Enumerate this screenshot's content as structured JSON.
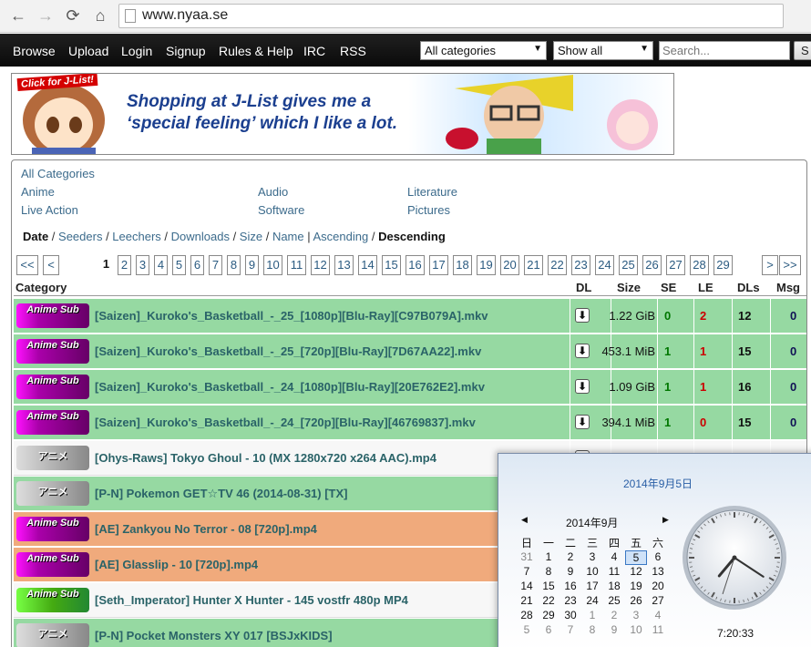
{
  "browser": {
    "url": "www.nyaa.se",
    "back_icon": "←",
    "forward_icon": "→",
    "reload_icon": "⟳",
    "home_icon": "⌂"
  },
  "nav": {
    "links": [
      "Browse",
      "Upload",
      "Login",
      "Signup",
      "Rules & Help",
      "IRC",
      "RSS"
    ],
    "category_select": "All categories",
    "filter_select": "Show all",
    "search_placeholder": "Search...",
    "search_button": "S"
  },
  "banner": {
    "tag": "Click for J-List!",
    "line1": "Shopping at J-List gives me a",
    "line2": "‘special feeling’ which I like a lot."
  },
  "categories": {
    "all": "All Categories",
    "anime": "Anime",
    "live_action": "Live Action",
    "audio": "Audio",
    "software": "Software",
    "literature": "Literature",
    "pictures": "Pictures"
  },
  "sort": {
    "date": "Date",
    "seeders": "Seeders",
    "leechers": "Leechers",
    "downloads": "Downloads",
    "size": "Size",
    "name": "Name",
    "ascending": "Ascending",
    "descending": "Descending"
  },
  "pagination": {
    "first": "<<",
    "prev": "<",
    "pages": [
      "1",
      "2",
      "3",
      "4",
      "5",
      "6",
      "7",
      "8",
      "9",
      "10",
      "11",
      "12",
      "13",
      "14",
      "15",
      "16",
      "17",
      "18",
      "19",
      "20",
      "21",
      "22",
      "23",
      "24",
      "25",
      "26",
      "27",
      "28",
      "29"
    ],
    "current": "1",
    "next": ">",
    "last": ">>"
  },
  "table": {
    "headers": {
      "category": "Category",
      "dl": "DL",
      "size": "Size",
      "se": "SE",
      "le": "LE",
      "dls": "DLs",
      "msg": "Msg"
    },
    "rows": [
      {
        "badge": "Anime Sub",
        "badge_type": "sub",
        "color": "green",
        "name": "[Saizen]_Kuroko's_Basketball_-_25_[1080p][Blu-Ray][C97B079A].mkv",
        "size": "1.22 GiB",
        "se": "0",
        "le": "2",
        "dls": "12",
        "msg": "0"
      },
      {
        "badge": "Anime Sub",
        "badge_type": "sub",
        "color": "green",
        "name": "[Saizen]_Kuroko's_Basketball_-_25_[720p][Blu-Ray][7D67AA22].mkv",
        "size": "453.1 MiB",
        "se": "1",
        "le": "1",
        "dls": "15",
        "msg": "0"
      },
      {
        "badge": "Anime Sub",
        "badge_type": "sub",
        "color": "green",
        "name": "[Saizen]_Kuroko's_Basketball_-_24_[1080p][Blu-Ray][20E762E2].mkv",
        "size": "1.09 GiB",
        "se": "1",
        "le": "1",
        "dls": "16",
        "msg": "0"
      },
      {
        "badge": "Anime Sub",
        "badge_type": "sub",
        "color": "green",
        "name": "[Saizen]_Kuroko's_Basketball_-_24_[720p][Blu-Ray][46769837].mkv",
        "size": "394.1 MiB",
        "se": "1",
        "le": "0",
        "dls": "15",
        "msg": "0"
      },
      {
        "badge": "アニメ",
        "badge_type": "raw",
        "color": "white",
        "name": "[Ohys-Raws] Tokyo Ghoul - 10 (MX 1280x720 x264 AAC).mp4",
        "size": "",
        "se": "",
        "le": "",
        "dls": "",
        "msg": ""
      },
      {
        "badge": "アニメ",
        "badge_type": "raw",
        "color": "green",
        "name": "[P-N] Pokemon GET☆TV 46 (2014-08-31) [TX]",
        "size": "",
        "se": "",
        "le": "",
        "dls": "",
        "msg": ""
      },
      {
        "badge": "Anime Sub",
        "badge_type": "sub",
        "color": "orange",
        "name": "[AE] Zankyou No Terror - 08 [720p].mp4",
        "size": "",
        "se": "",
        "le": "",
        "dls": "",
        "msg": ""
      },
      {
        "badge": "Anime Sub",
        "badge_type": "sub",
        "color": "orange",
        "name": "[AE] Glasslip - 10 [720p].mp4",
        "size": "",
        "se": "",
        "le": "",
        "dls": "",
        "msg": ""
      },
      {
        "badge": "Anime Sub",
        "badge_type": "nonen",
        "color": "white",
        "name": "[Seth_Imperator] Hunter X Hunter - 145 vostfr 480p MP4",
        "size": "",
        "se": "",
        "le": "",
        "dls": "",
        "msg": ""
      },
      {
        "badge": "アニメ",
        "badge_type": "raw",
        "color": "green",
        "name": "[P-N] Pocket Monsters XY 017 [BSJxKIDS]",
        "size": "",
        "se": "",
        "le": "",
        "dls": "",
        "msg": ""
      }
    ]
  },
  "calendar": {
    "full_date": "2014年9月5日",
    "month": "2014年9月",
    "weekdays": [
      "日",
      "一",
      "二",
      "三",
      "四",
      "五",
      "六"
    ],
    "weeks": [
      [
        "31",
        "1",
        "2",
        "3",
        "4",
        "5",
        "6"
      ],
      [
        "7",
        "8",
        "9",
        "10",
        "11",
        "12",
        "13"
      ],
      [
        "14",
        "15",
        "16",
        "17",
        "18",
        "19",
        "20"
      ],
      [
        "21",
        "22",
        "23",
        "24",
        "25",
        "26",
        "27"
      ],
      [
        "28",
        "29",
        "30",
        "1",
        "2",
        "3",
        "4"
      ],
      [
        "5",
        "6",
        "7",
        "8",
        "9",
        "10",
        "11"
      ]
    ],
    "today": "5",
    "time": "7:20:33",
    "clock_hours": 7,
    "clock_minutes": 20,
    "clock_seconds": 33
  }
}
